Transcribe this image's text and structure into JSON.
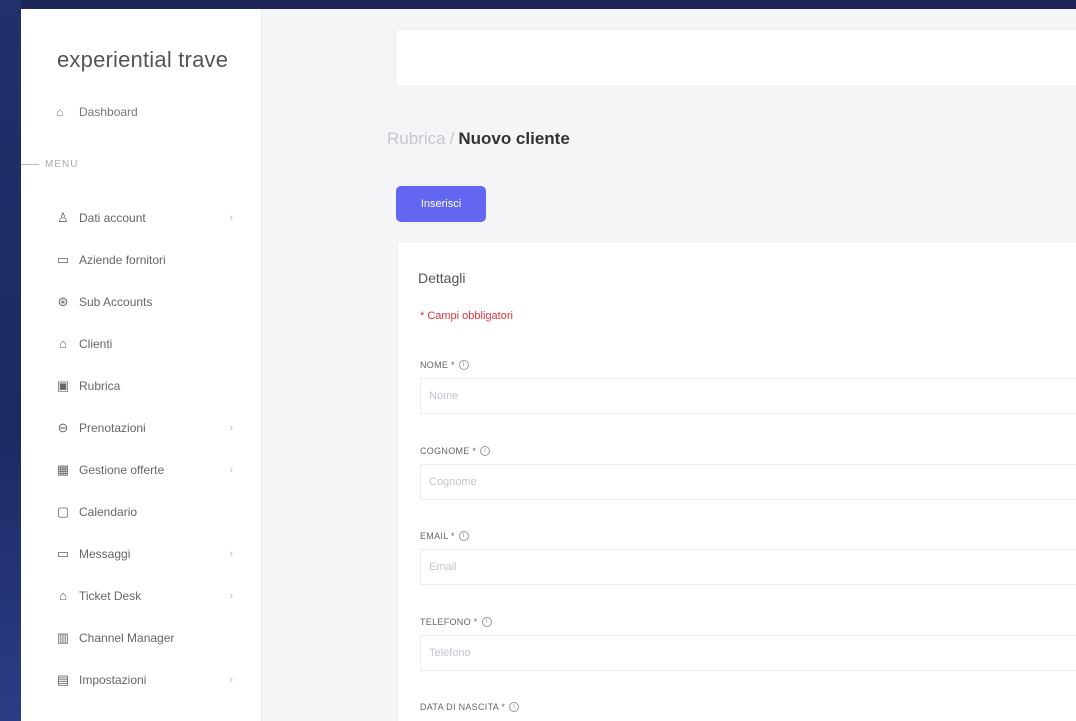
{
  "brand": "experiential trave",
  "sidebar": {
    "dashboard_label": "Dashboard",
    "section_label": "MENU",
    "items": [
      {
        "label": "Dati account",
        "icon": "user-icon",
        "has_submenu": true
      },
      {
        "label": "Aziende fornitori",
        "icon": "card-icon",
        "has_submenu": false
      },
      {
        "label": "Sub Accounts",
        "icon": "settings-circle-icon",
        "has_submenu": false
      },
      {
        "label": "Clienti",
        "icon": "bag-icon",
        "has_submenu": false
      },
      {
        "label": "Rubrica",
        "icon": "contacts-book-icon",
        "has_submenu": false
      },
      {
        "label": "Prenotazioni",
        "icon": "swap-circle-icon",
        "has_submenu": true
      },
      {
        "label": "Gestione offerte",
        "icon": "calendar-grid-icon",
        "has_submenu": true
      },
      {
        "label": "Calendario",
        "icon": "calendar-icon",
        "has_submenu": false
      },
      {
        "label": "Messaggi",
        "icon": "monitor-icon",
        "has_submenu": true
      },
      {
        "label": "Ticket Desk",
        "icon": "ticket-icon",
        "has_submenu": true
      },
      {
        "label": "Channel Manager",
        "icon": "bank-icon",
        "has_submenu": false
      },
      {
        "label": "Impostazioni",
        "icon": "gear-box-icon",
        "has_submenu": true
      }
    ]
  },
  "breadcrumb": {
    "parent": "Rubrica",
    "separator": "/",
    "current": "Nuovo cliente"
  },
  "submit_button": "Inserisci",
  "card": {
    "title": "Dettagli",
    "required_note": "* Campi obbligatori",
    "fields": [
      {
        "label": "NOME *",
        "placeholder": "Nome"
      },
      {
        "label": "COGNOME *",
        "placeholder": "Cognome"
      },
      {
        "label": "EMAIL *",
        "placeholder": "Email"
      },
      {
        "label": "TELEFONO *",
        "placeholder": "Telefono"
      },
      {
        "label": "DATA DI NASCITA *",
        "placeholder": ""
      }
    ]
  },
  "colors": {
    "accent": "#6366f1",
    "required": "#e0323d"
  }
}
